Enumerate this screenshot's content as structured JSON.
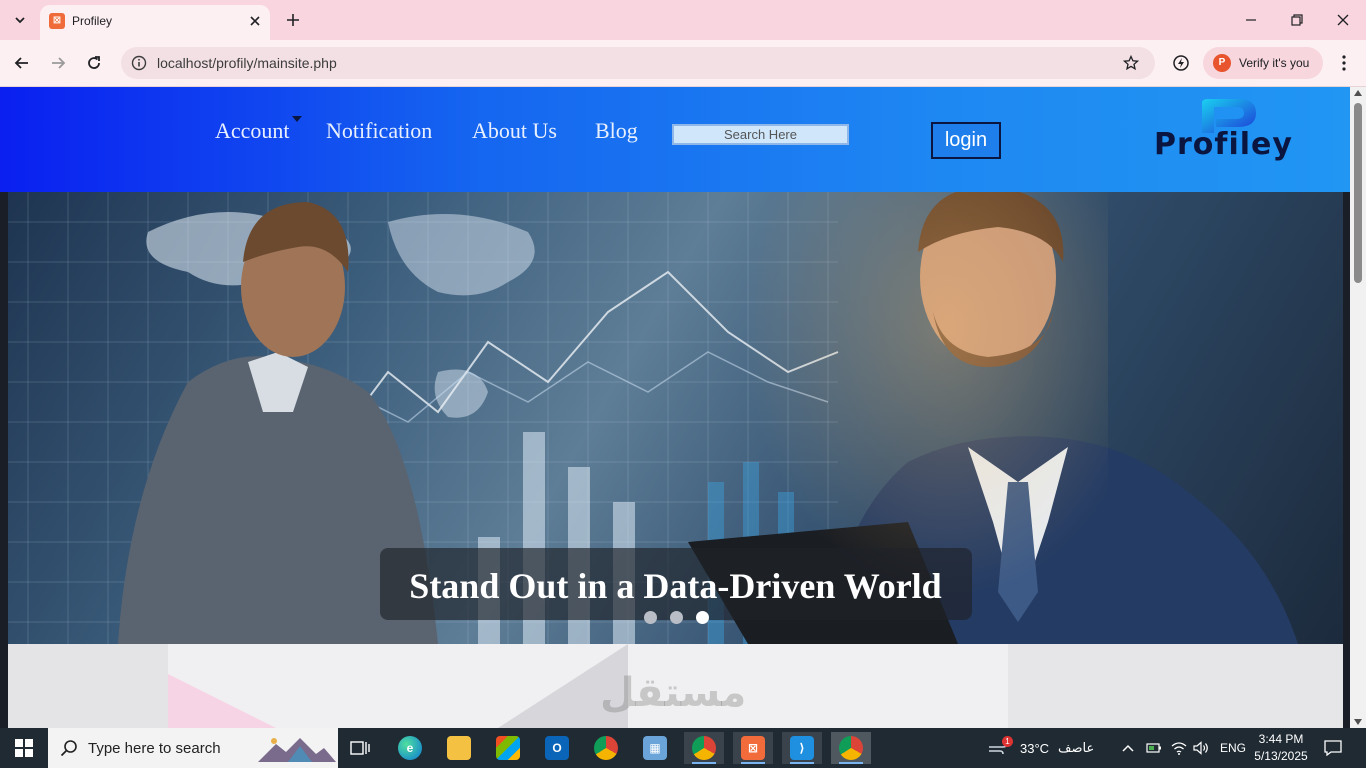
{
  "browser": {
    "tab_title": "Profiley",
    "url": "localhost/profily/mainsite.php",
    "profile_label": "Verify it's you",
    "profile_initial": "P"
  },
  "site": {
    "nav": {
      "account": "Account",
      "notification": "Notification",
      "about": "About Us",
      "blog": "Blog"
    },
    "search_placeholder": "Search Here",
    "login_label": "login",
    "logo_text": "Profiley",
    "hero_title": "Stand Out in a Data-Driven World",
    "slider_dots": 3,
    "active_dot": 3,
    "watermark": "مستقل"
  },
  "taskbar": {
    "search_placeholder": "Type here to search",
    "weather": "33°C",
    "weather_label": "عاصف",
    "weather_badge": "1",
    "language": "ENG",
    "time": "3:44 PM",
    "date": "5/13/2025"
  },
  "colors": {
    "header_start": "#0a1ff0",
    "header_end": "#2196f3",
    "tabbar": "#f9d6df",
    "taskbar": "#1f2a33"
  }
}
